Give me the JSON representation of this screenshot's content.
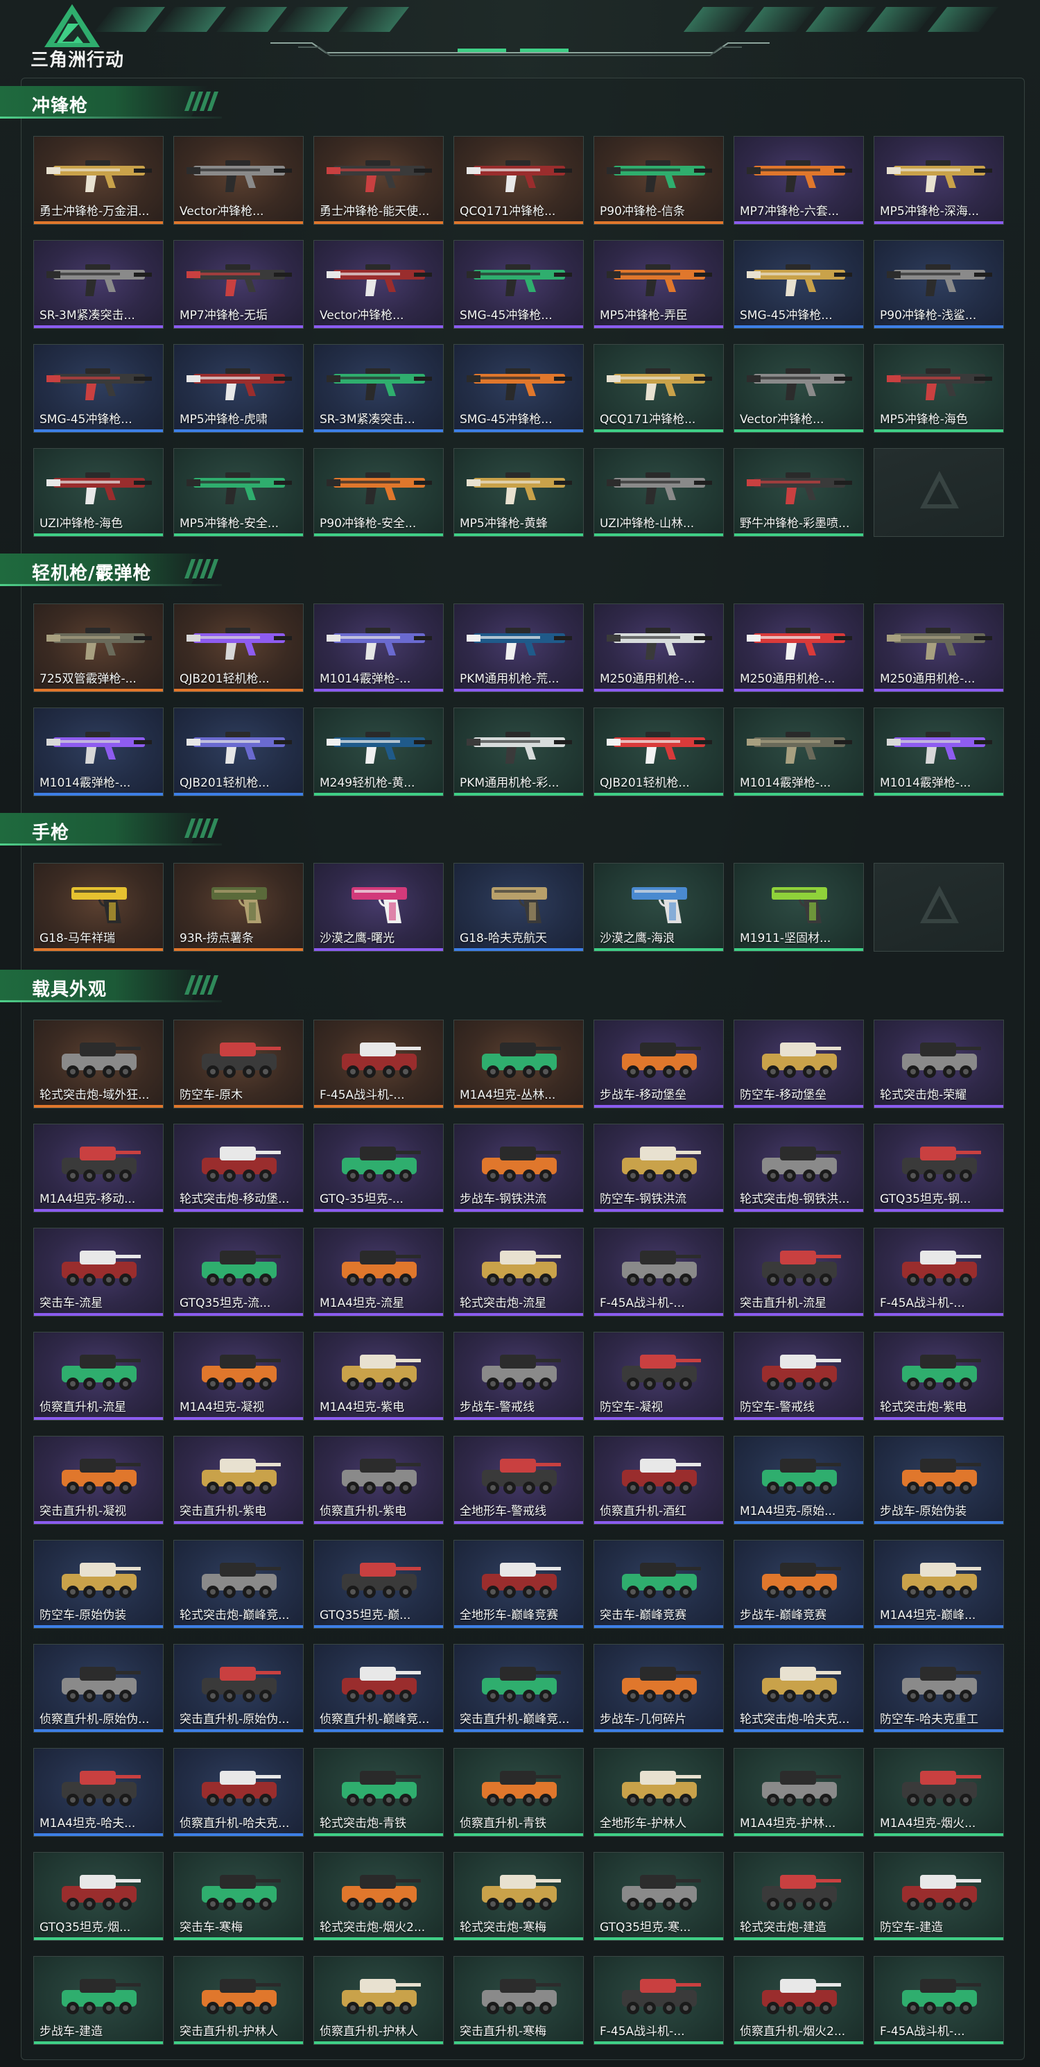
{
  "app": {
    "brand": "三角洲行动",
    "logo_icon": "delta-force-logo-icon"
  },
  "colors": {
    "accent": "#3fcf86",
    "rarity_orange": "#e0772c",
    "rarity_purple": "#8b5cf0",
    "rarity_blue": "#3d7fe6",
    "rarity_green": "#3fcf86"
  },
  "sections": [
    {
      "title": "冲锋枪",
      "kind": "gun",
      "items": [
        {
          "name": "勇士冲锋枪-万金泪...",
          "rarity": "orange"
        },
        {
          "name": "Vector冲锋枪...",
          "rarity": "orange"
        },
        {
          "name": "勇士冲锋枪-能天使...",
          "rarity": "orange"
        },
        {
          "name": "QCQ171冲锋枪...",
          "rarity": "orange"
        },
        {
          "name": "P90冲锋枪-信条",
          "rarity": "orange"
        },
        {
          "name": "MP7冲锋枪-六套...",
          "rarity": "purple"
        },
        {
          "name": "MP5冲锋枪-深海...",
          "rarity": "purple"
        },
        {
          "name": "SR-3M紧凑突击...",
          "rarity": "purple"
        },
        {
          "name": "MP7冲锋枪-无垢",
          "rarity": "purple"
        },
        {
          "name": "Vector冲锋枪...",
          "rarity": "purple"
        },
        {
          "name": "SMG-45冲锋枪...",
          "rarity": "purple"
        },
        {
          "name": "MP5冲锋枪-弄臣",
          "rarity": "purple"
        },
        {
          "name": "SMG-45冲锋枪...",
          "rarity": "blue"
        },
        {
          "name": "P90冲锋枪-浅鲨...",
          "rarity": "blue"
        },
        {
          "name": "SMG-45冲锋枪...",
          "rarity": "blue"
        },
        {
          "name": "MP5冲锋枪-虎啸",
          "rarity": "blue"
        },
        {
          "name": "SR-3M紧凑突击...",
          "rarity": "blue"
        },
        {
          "name": "SMG-45冲锋枪...",
          "rarity": "blue"
        },
        {
          "name": "QCQ171冲锋枪...",
          "rarity": "green"
        },
        {
          "name": "Vector冲锋枪...",
          "rarity": "green"
        },
        {
          "name": "MP5冲锋枪-海色",
          "rarity": "green"
        },
        {
          "name": "UZI冲锋枪-海色",
          "rarity": "green"
        },
        {
          "name": "MP5冲锋枪-安全...",
          "rarity": "green"
        },
        {
          "name": "P90冲锋枪-安全...",
          "rarity": "green"
        },
        {
          "name": "MP5冲锋枪-黄蜂",
          "rarity": "green"
        },
        {
          "name": "UZI冲锋枪-山林...",
          "rarity": "green"
        },
        {
          "name": "野牛冲锋枪-彩墨喷...",
          "rarity": "green"
        },
        {
          "name": "",
          "rarity": "empty"
        }
      ]
    },
    {
      "title": "轻机枪/霰弹枪",
      "kind": "gun",
      "items": [
        {
          "name": "725双管霰弹枪-...",
          "rarity": "orange"
        },
        {
          "name": "QJB201轻机枪...",
          "rarity": "orange"
        },
        {
          "name": "M1014霰弹枪-...",
          "rarity": "purple"
        },
        {
          "name": "PKM通用机枪-荒...",
          "rarity": "purple"
        },
        {
          "name": "M250通用机枪-...",
          "rarity": "purple"
        },
        {
          "name": "M250通用机枪-...",
          "rarity": "purple"
        },
        {
          "name": "M250通用机枪-...",
          "rarity": "purple"
        },
        {
          "name": "M1014霰弹枪-...",
          "rarity": "blue"
        },
        {
          "name": "QJB201轻机枪...",
          "rarity": "blue"
        },
        {
          "name": "M249轻机枪-黄...",
          "rarity": "green"
        },
        {
          "name": "PKM通用机枪-彩...",
          "rarity": "green"
        },
        {
          "name": "QJB201轻机枪...",
          "rarity": "green"
        },
        {
          "name": "M1014霰弹枪-...",
          "rarity": "green"
        },
        {
          "name": "M1014霰弹枪-...",
          "rarity": "green"
        }
      ]
    },
    {
      "title": "手枪",
      "kind": "pistol",
      "items": [
        {
          "name": "G18-马年祥瑞",
          "rarity": "orange"
        },
        {
          "name": "93R-捞点薯条",
          "rarity": "orange"
        },
        {
          "name": "沙漠之鹰-曙光",
          "rarity": "purple"
        },
        {
          "name": "G18-哈夫克航天",
          "rarity": "blue"
        },
        {
          "name": "沙漠之鹰-海浪",
          "rarity": "green"
        },
        {
          "name": "M1911-坚固材...",
          "rarity": "green"
        },
        {
          "name": "",
          "rarity": "empty"
        }
      ]
    },
    {
      "title": "载具外观",
      "kind": "vehicle",
      "items": [
        {
          "name": "轮式突击炮-域外狂...",
          "rarity": "orange"
        },
        {
          "name": "防空车-原木",
          "rarity": "orange"
        },
        {
          "name": "F-45A战斗机-...",
          "rarity": "orange"
        },
        {
          "name": "M1A4坦克-丛林...",
          "rarity": "orange"
        },
        {
          "name": "步战车-移动堡垒",
          "rarity": "purple"
        },
        {
          "name": "防空车-移动堡垒",
          "rarity": "purple"
        },
        {
          "name": "轮式突击炮-荣耀",
          "rarity": "purple"
        },
        {
          "name": "M1A4坦克-移动...",
          "rarity": "purple"
        },
        {
          "name": "轮式突击炮-移动堡...",
          "rarity": "purple"
        },
        {
          "name": "GTQ-35坦克-...",
          "rarity": "purple"
        },
        {
          "name": "步战车-钢铁洪流",
          "rarity": "purple"
        },
        {
          "name": "防空车-钢铁洪流",
          "rarity": "purple"
        },
        {
          "name": "轮式突击炮-钢铁洪...",
          "rarity": "purple"
        },
        {
          "name": "GTQ35坦克-钢...",
          "rarity": "purple"
        },
        {
          "name": "突击车-流星",
          "rarity": "purple"
        },
        {
          "name": "GTQ35坦克-流...",
          "rarity": "purple"
        },
        {
          "name": "M1A4坦克-流星",
          "rarity": "purple"
        },
        {
          "name": "轮式突击炮-流星",
          "rarity": "purple"
        },
        {
          "name": "F-45A战斗机-...",
          "rarity": "purple"
        },
        {
          "name": "突击直升机-流星",
          "rarity": "purple"
        },
        {
          "name": "F-45A战斗机-...",
          "rarity": "purple"
        },
        {
          "name": "侦察直升机-流星",
          "rarity": "purple"
        },
        {
          "name": "M1A4坦克-凝视",
          "rarity": "purple"
        },
        {
          "name": "M1A4坦克-紫电",
          "rarity": "purple"
        },
        {
          "name": "步战车-警戒线",
          "rarity": "purple"
        },
        {
          "name": "防空车-凝视",
          "rarity": "purple"
        },
        {
          "name": "防空车-警戒线",
          "rarity": "purple"
        },
        {
          "name": "轮式突击炮-紫电",
          "rarity": "purple"
        },
        {
          "name": "突击直升机-凝视",
          "rarity": "purple"
        },
        {
          "name": "突击直升机-紫电",
          "rarity": "purple"
        },
        {
          "name": "侦察直升机-紫电",
          "rarity": "purple"
        },
        {
          "name": "全地形车-警戒线",
          "rarity": "purple"
        },
        {
          "name": "侦察直升机-酒红",
          "rarity": "purple"
        },
        {
          "name": "M1A4坦克-原始...",
          "rarity": "blue"
        },
        {
          "name": "步战车-原始伪装",
          "rarity": "blue"
        },
        {
          "name": "防空车-原始伪装",
          "rarity": "blue"
        },
        {
          "name": "轮式突击炮-巅峰竞...",
          "rarity": "blue"
        },
        {
          "name": "GTQ35坦克-巅...",
          "rarity": "blue"
        },
        {
          "name": "全地形车-巅峰竞赛",
          "rarity": "blue"
        },
        {
          "name": "突击车-巅峰竞赛",
          "rarity": "blue"
        },
        {
          "name": "步战车-巅峰竞赛",
          "rarity": "blue"
        },
        {
          "name": "M1A4坦克-巅峰...",
          "rarity": "blue"
        },
        {
          "name": "侦察直升机-原始伪...",
          "rarity": "blue"
        },
        {
          "name": "突击直升机-原始伪...",
          "rarity": "blue"
        },
        {
          "name": "侦察直升机-巅峰竞...",
          "rarity": "blue"
        },
        {
          "name": "突击直升机-巅峰竞...",
          "rarity": "blue"
        },
        {
          "name": "步战车-几何碎片",
          "rarity": "blue"
        },
        {
          "name": "轮式突击炮-哈夫克...",
          "rarity": "blue"
        },
        {
          "name": "防空车-哈夫克重工",
          "rarity": "blue"
        },
        {
          "name": "M1A4坦克-哈夫...",
          "rarity": "blue"
        },
        {
          "name": "侦察直升机-哈夫克...",
          "rarity": "blue"
        },
        {
          "name": "轮式突击炮-青铁",
          "rarity": "green"
        },
        {
          "name": "侦察直升机-青铁",
          "rarity": "green"
        },
        {
          "name": "全地形车-护林人",
          "rarity": "green"
        },
        {
          "name": "M1A4坦克-护林...",
          "rarity": "green"
        },
        {
          "name": "M1A4坦克-烟火...",
          "rarity": "green"
        },
        {
          "name": "GTQ35坦克-烟...",
          "rarity": "green"
        },
        {
          "name": "突击车-寒梅",
          "rarity": "green"
        },
        {
          "name": "轮式突击炮-烟火2...",
          "rarity": "green"
        },
        {
          "name": "轮式突击炮-寒梅",
          "rarity": "green"
        },
        {
          "name": "GTQ35坦克-寒...",
          "rarity": "green"
        },
        {
          "name": "轮式突击炮-建造",
          "rarity": "green"
        },
        {
          "name": "防空车-建造",
          "rarity": "green"
        },
        {
          "name": "步战车-建造",
          "rarity": "green"
        },
        {
          "name": "突击直升机-护林人",
          "rarity": "green"
        },
        {
          "name": "侦察直升机-护林人",
          "rarity": "green"
        },
        {
          "name": "突击直升机-寒梅",
          "rarity": "green"
        },
        {
          "name": "F-45A战斗机-...",
          "rarity": "green"
        },
        {
          "name": "侦察直升机-烟火2...",
          "rarity": "green"
        },
        {
          "name": "F-45A战斗机-...",
          "rarity": "green"
        }
      ]
    }
  ]
}
